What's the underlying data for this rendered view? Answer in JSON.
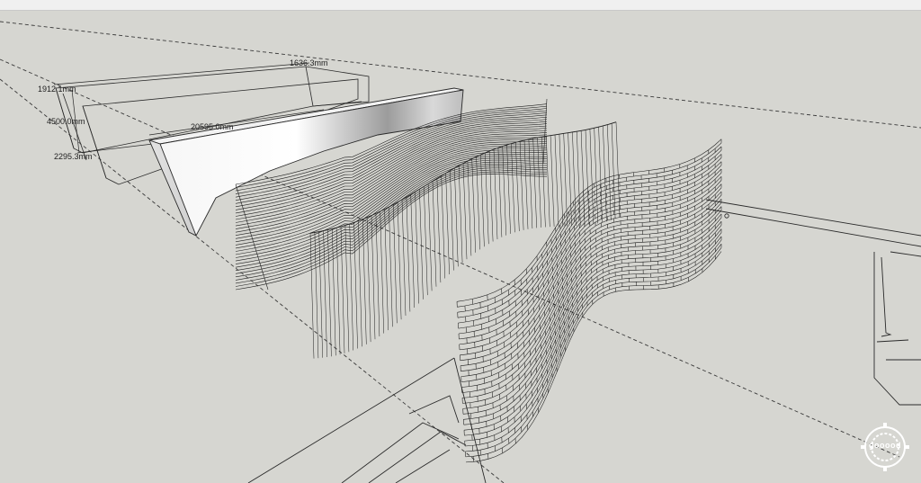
{
  "dimensions": {
    "width_1": "1636.3mm",
    "height_1": "1912.1mm",
    "height_2": "4500.0mm",
    "length": "20595.0mm",
    "depth": "2295.3mm"
  },
  "watermark": {
    "text": "gooood"
  },
  "colors": {
    "background": "#d6d6d1",
    "line": "#2a2a2a",
    "guide": "#3a3a3a"
  },
  "icons": [
    "watermark-logo-icon"
  ]
}
